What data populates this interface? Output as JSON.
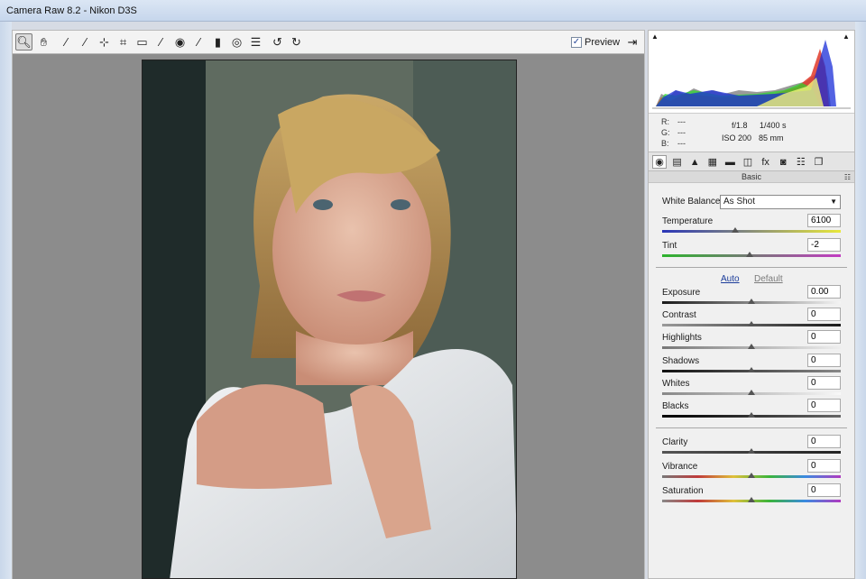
{
  "window": {
    "title": "Camera Raw 8.2  -  Nikon D3S"
  },
  "toolbar": {
    "tools": [
      {
        "name": "zoom-tool",
        "icon": "zoom-icon",
        "glyph": "🔍︎",
        "active": true
      },
      {
        "name": "hand-tool",
        "icon": "hand-icon",
        "glyph": "✋︎"
      },
      {
        "name": "white-balance-tool",
        "icon": "eyedropper-icon",
        "glyph": "⁄"
      },
      {
        "name": "color-sampler-tool",
        "icon": "color-sampler-icon",
        "glyph": "⁄"
      },
      {
        "name": "targeted-adjustment-tool",
        "icon": "target-adjust-icon",
        "glyph": "⊹"
      },
      {
        "name": "crop-tool",
        "icon": "crop-icon",
        "glyph": "⌗"
      },
      {
        "name": "straighten-tool",
        "icon": "straighten-icon",
        "glyph": "▭"
      },
      {
        "name": "spot-removal-tool",
        "icon": "spot-removal-icon",
        "glyph": "⁄"
      },
      {
        "name": "red-eye-tool",
        "icon": "red-eye-icon",
        "glyph": "◉"
      },
      {
        "name": "adjustment-brush-tool",
        "icon": "brush-icon",
        "glyph": "⁄"
      },
      {
        "name": "graduated-filter-tool",
        "icon": "graduated-filter-icon",
        "glyph": "▮"
      },
      {
        "name": "radial-filter-tool",
        "icon": "radial-filter-icon",
        "glyph": "◎"
      },
      {
        "name": "preferences-tool",
        "icon": "list-icon",
        "glyph": "☰"
      },
      {
        "name": "rotate-left-tool",
        "icon": "rotate-left-icon",
        "glyph": "↺"
      },
      {
        "name": "rotate-right-tool",
        "icon": "rotate-right-icon",
        "glyph": "↻"
      }
    ],
    "preview_label": "Preview",
    "preview_checked": "✓",
    "fullscreen_glyph": "⇥"
  },
  "histogram": {
    "r_label": "R:",
    "g_label": "G:",
    "b_label": "B:",
    "r_value": "---",
    "g_value": "---",
    "b_value": "---",
    "aperture": "f/1.8",
    "shutter": "1/400 s",
    "iso": "ISO 200",
    "focal": "85 mm"
  },
  "tabs": [
    {
      "name": "tab-basic",
      "icon": "aperture-icon",
      "glyph": "◉",
      "active": true
    },
    {
      "name": "tab-tone-curve",
      "icon": "tone-curve-icon",
      "glyph": "▤"
    },
    {
      "name": "tab-detail",
      "icon": "detail-icon",
      "glyph": "▲"
    },
    {
      "name": "tab-hsl",
      "icon": "hsl-icon",
      "glyph": "▦"
    },
    {
      "name": "tab-split-toning",
      "icon": "split-toning-icon",
      "glyph": "▬"
    },
    {
      "name": "tab-lens-corrections",
      "icon": "lens-icon",
      "glyph": "◫"
    },
    {
      "name": "tab-effects",
      "icon": "fx-icon",
      "glyph": "fx"
    },
    {
      "name": "tab-camera-calibration",
      "icon": "camera-icon",
      "glyph": "◙"
    },
    {
      "name": "tab-presets",
      "icon": "presets-icon",
      "glyph": "☷"
    },
    {
      "name": "tab-snapshots",
      "icon": "snapshots-icon",
      "glyph": "❐"
    }
  ],
  "basic": {
    "section_title": "Basic",
    "white_balance_label": "White Balance:",
    "white_balance_value": "As Shot",
    "temperature_label": "Temperature",
    "temperature_value": "6100",
    "temperature_level": 0.41,
    "tint_label": "Tint",
    "tint_value": "-2",
    "tint_level": 0.49,
    "auto_label": "Auto",
    "default_label": "Default",
    "exposure_label": "Exposure",
    "exposure_value": "0.00",
    "contrast_label": "Contrast",
    "contrast_value": "0",
    "highlights_label": "Highlights",
    "highlights_value": "0",
    "shadows_label": "Shadows",
    "shadows_value": "0",
    "whites_label": "Whites",
    "whites_value": "0",
    "blacks_label": "Blacks",
    "blacks_value": "0",
    "clarity_label": "Clarity",
    "clarity_value": "0",
    "vibrance_label": "Vibrance",
    "vibrance_value": "0",
    "saturation_label": "Saturation",
    "saturation_value": "0"
  },
  "colors": {
    "accent_link": "#1b3c9a",
    "canvas": "#8c8c8c",
    "panel": "#f0f0f0"
  }
}
